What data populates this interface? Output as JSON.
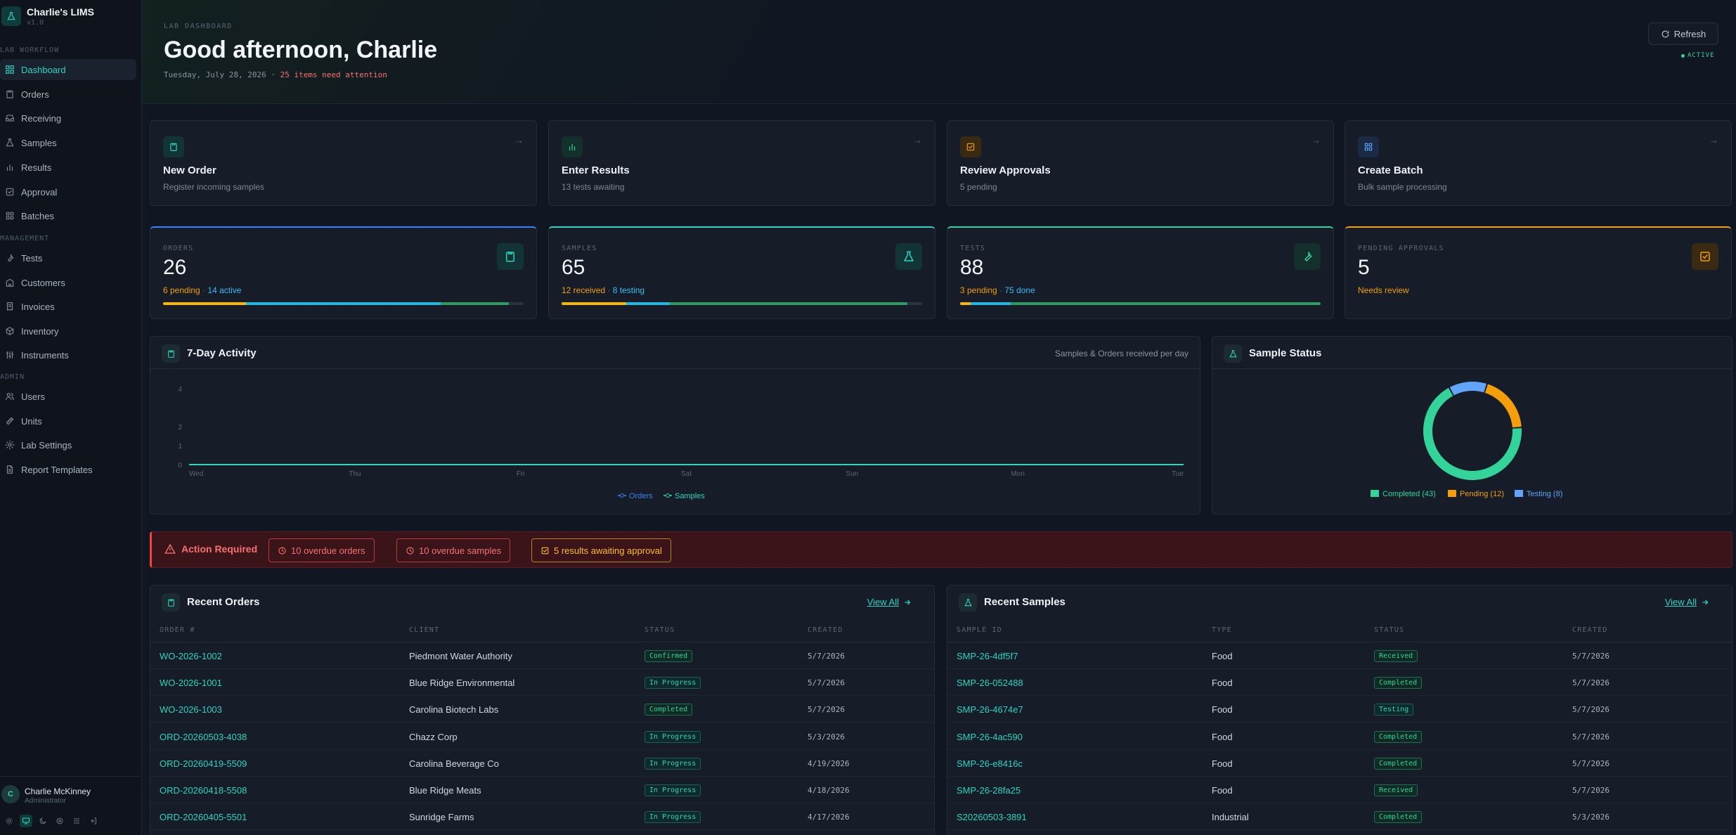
{
  "app": {
    "name": "Charlie's LIMS",
    "version": "v1.0"
  },
  "sidebar": {
    "sections": [
      {
        "title": "LAB WORKFLOW",
        "items": [
          {
            "label": "Dashboard",
            "icon": "dashboard-icon",
            "active": true
          },
          {
            "label": "Orders",
            "icon": "clipboard-icon"
          },
          {
            "label": "Receiving",
            "icon": "inbox-icon"
          },
          {
            "label": "Samples",
            "icon": "flask-icon"
          },
          {
            "label": "Results",
            "icon": "bar-chart-icon"
          },
          {
            "label": "Approval",
            "icon": "check-square-icon"
          },
          {
            "label": "Batches",
            "icon": "grid-icon"
          }
        ]
      },
      {
        "title": "MANAGEMENT",
        "items": [
          {
            "label": "Tests",
            "icon": "wrench-icon"
          },
          {
            "label": "Customers",
            "icon": "building-icon"
          },
          {
            "label": "Invoices",
            "icon": "receipt-icon"
          },
          {
            "label": "Inventory",
            "icon": "box-icon"
          },
          {
            "label": "Instruments",
            "icon": "sliders-icon"
          }
        ]
      },
      {
        "title": "ADMIN",
        "items": [
          {
            "label": "Users",
            "icon": "users-icon"
          },
          {
            "label": "Units",
            "icon": "ruler-icon"
          },
          {
            "label": "Lab Settings",
            "icon": "gear-icon"
          },
          {
            "label": "Report Templates",
            "icon": "file-icon"
          }
        ]
      }
    ],
    "user": {
      "initial": "C",
      "name": "Charlie McKinney",
      "role": "Administrator"
    }
  },
  "header": {
    "eyebrow": "LAB DASHBOARD",
    "greeting": "Good afternoon, Charlie",
    "date": "Tuesday, July 28, 2026",
    "separator": " · ",
    "attention": "25 items need attention",
    "refresh_label": "Refresh",
    "status": "ACTIVE"
  },
  "quick_actions": [
    {
      "title": "New Order",
      "sub": "Register incoming samples",
      "icon": "clipboard-icon",
      "color": "#2dd4bf",
      "bg": "#133437"
    },
    {
      "title": "Enter Results",
      "sub": "13 tests awaiting",
      "icon": "bar-chart-icon",
      "color": "#34d399",
      "bg": "#13302a"
    },
    {
      "title": "Review Approvals",
      "sub": "5 pending",
      "icon": "check-square-icon",
      "color": "#f59e0b",
      "bg": "#3a2a12"
    },
    {
      "title": "Create Batch",
      "sub": "Bulk sample processing",
      "icon": "grid-icon",
      "color": "#60a5fa",
      "bg": "#1a2944"
    }
  ],
  "stats": [
    {
      "label": "ORDERS",
      "value": "26",
      "sub_a": "6 pending",
      "sub_sep": " · ",
      "sub_b": "14 active",
      "accent": "#3b82f6",
      "icon": "clipboard-icon",
      "icon_color": "#2dd4bf",
      "icon_bg": "#133437",
      "progress": [
        0.23,
        0.54,
        0.19
      ]
    },
    {
      "label": "SAMPLES",
      "value": "65",
      "sub_a": "12 received",
      "sub_sep": " · ",
      "sub_b": "8 testing",
      "accent": "#2dd4bf",
      "icon": "flask-icon",
      "icon_color": "#2dd4bf",
      "icon_bg": "#133437",
      "progress": [
        0.18,
        0.12,
        0.66
      ]
    },
    {
      "label": "TESTS",
      "value": "88",
      "sub_a": "3 pending",
      "sub_sep": " · ",
      "sub_b": "75 done",
      "accent": "#34d399",
      "icon": "wrench-icon",
      "icon_color": "#34d399",
      "icon_bg": "#13302a",
      "progress": [
        0.03,
        0.11,
        0.86
      ]
    },
    {
      "label": "PENDING APPROVALS",
      "value": "5",
      "sub_a": "Needs review",
      "sub_sep": "",
      "sub_b": "",
      "accent": "#f59e0b",
      "icon": "check-square-icon",
      "icon_color": "#f59e0b",
      "icon_bg": "#3a2a12",
      "progress": []
    }
  ],
  "activity": {
    "title": "7-Day Activity",
    "note": "Samples & Orders received per day",
    "chart_data": {
      "type": "line",
      "x": [
        "Wed",
        "Thu",
        "Fri",
        "Sat",
        "Sun",
        "Mon",
        "Tue"
      ],
      "y_ticks": [
        "0",
        "1",
        "2",
        "4"
      ],
      "ylim": [
        0,
        4
      ],
      "series": [
        {
          "name": "Orders",
          "values": [
            0,
            0,
            0,
            0,
            0,
            0,
            0
          ],
          "color": "#3b82f6"
        },
        {
          "name": "Samples",
          "values": [
            0,
            0,
            0,
            0,
            0,
            0,
            0
          ],
          "color": "#2dd4bf"
        }
      ],
      "legend": "bottom-center",
      "grid": false
    }
  },
  "sample_status": {
    "title": "Sample Status",
    "chart_data": {
      "type": "pie",
      "slices": [
        {
          "label": "Completed (43)",
          "value": 43,
          "color": "#34d399"
        },
        {
          "label": "Pending (12)",
          "value": 12,
          "color": "#f59e0b"
        },
        {
          "label": "Testing (8)",
          "value": 8,
          "color": "#60a5fa"
        }
      ],
      "legend": "bottom-center"
    }
  },
  "action_required": {
    "title": "Action Required",
    "chips": [
      {
        "label": "10 overdue orders",
        "icon": "clock-icon",
        "color": "#f87171",
        "border": "#b23b3b"
      },
      {
        "label": "10 overdue samples",
        "icon": "clock-icon",
        "color": "#f87171",
        "border": "#b23b3b"
      },
      {
        "label": "5 results awaiting approval",
        "icon": "check-square-icon",
        "color": "#fbbf24",
        "border": "#b4841f"
      }
    ]
  },
  "recent_orders": {
    "title": "Recent Orders",
    "view_all": "View All",
    "columns": [
      "ORDER #",
      "CLIENT",
      "STATUS",
      "CREATED"
    ],
    "rows": [
      {
        "id": "WO-2026-1002",
        "client": "Piedmont Water Authority",
        "status": "Confirmed",
        "cls": "b-confirmed",
        "created": "5/7/2026"
      },
      {
        "id": "WO-2026-1001",
        "client": "Blue Ridge Environmental",
        "status": "In Progress",
        "cls": "b-inprogress",
        "created": "5/7/2026"
      },
      {
        "id": "WO-2026-1003",
        "client": "Carolina Biotech Labs",
        "status": "Completed",
        "cls": "b-completed",
        "created": "5/7/2026"
      },
      {
        "id": "ORD-20260503-4038",
        "client": "Chazz Corp",
        "status": "In Progress",
        "cls": "b-inprogress",
        "created": "5/3/2026"
      },
      {
        "id": "ORD-20260419-5509",
        "client": "Carolina Beverage Co",
        "status": "In Progress",
        "cls": "b-inprogress",
        "created": "4/19/2026"
      },
      {
        "id": "ORD-20260418-5508",
        "client": "Blue Ridge Meats",
        "status": "In Progress",
        "cls": "b-inprogress",
        "created": "4/18/2026"
      },
      {
        "id": "ORD-20260405-5501",
        "client": "Sunridge Farms",
        "status": "In Progress",
        "cls": "b-inprogress",
        "created": "4/17/2026"
      }
    ]
  },
  "recent_samples": {
    "title": "Recent Samples",
    "view_all": "View All",
    "columns": [
      "SAMPLE ID",
      "TYPE",
      "STATUS",
      "CREATED"
    ],
    "rows": [
      {
        "id": "SMP-26-4df5f7",
        "type": "Food",
        "status": "Received",
        "cls": "b-received",
        "created": "5/7/2026"
      },
      {
        "id": "SMP-26-052488",
        "type": "Food",
        "status": "Completed",
        "cls": "b-completed",
        "created": "5/7/2026"
      },
      {
        "id": "SMP-26-4674e7",
        "type": "Food",
        "status": "Testing",
        "cls": "b-testing",
        "created": "5/7/2026"
      },
      {
        "id": "SMP-26-4ac590",
        "type": "Food",
        "status": "Completed",
        "cls": "b-completed",
        "created": "5/7/2026"
      },
      {
        "id": "SMP-26-e8416c",
        "type": "Food",
        "status": "Completed",
        "cls": "b-completed",
        "created": "5/7/2026"
      },
      {
        "id": "SMP-26-28fa25",
        "type": "Food",
        "status": "Received",
        "cls": "b-received",
        "created": "5/7/2026"
      },
      {
        "id": "S20260503-3891",
        "type": "Industrial",
        "status": "Completed",
        "cls": "b-completed",
        "created": "5/3/2026"
      }
    ]
  }
}
